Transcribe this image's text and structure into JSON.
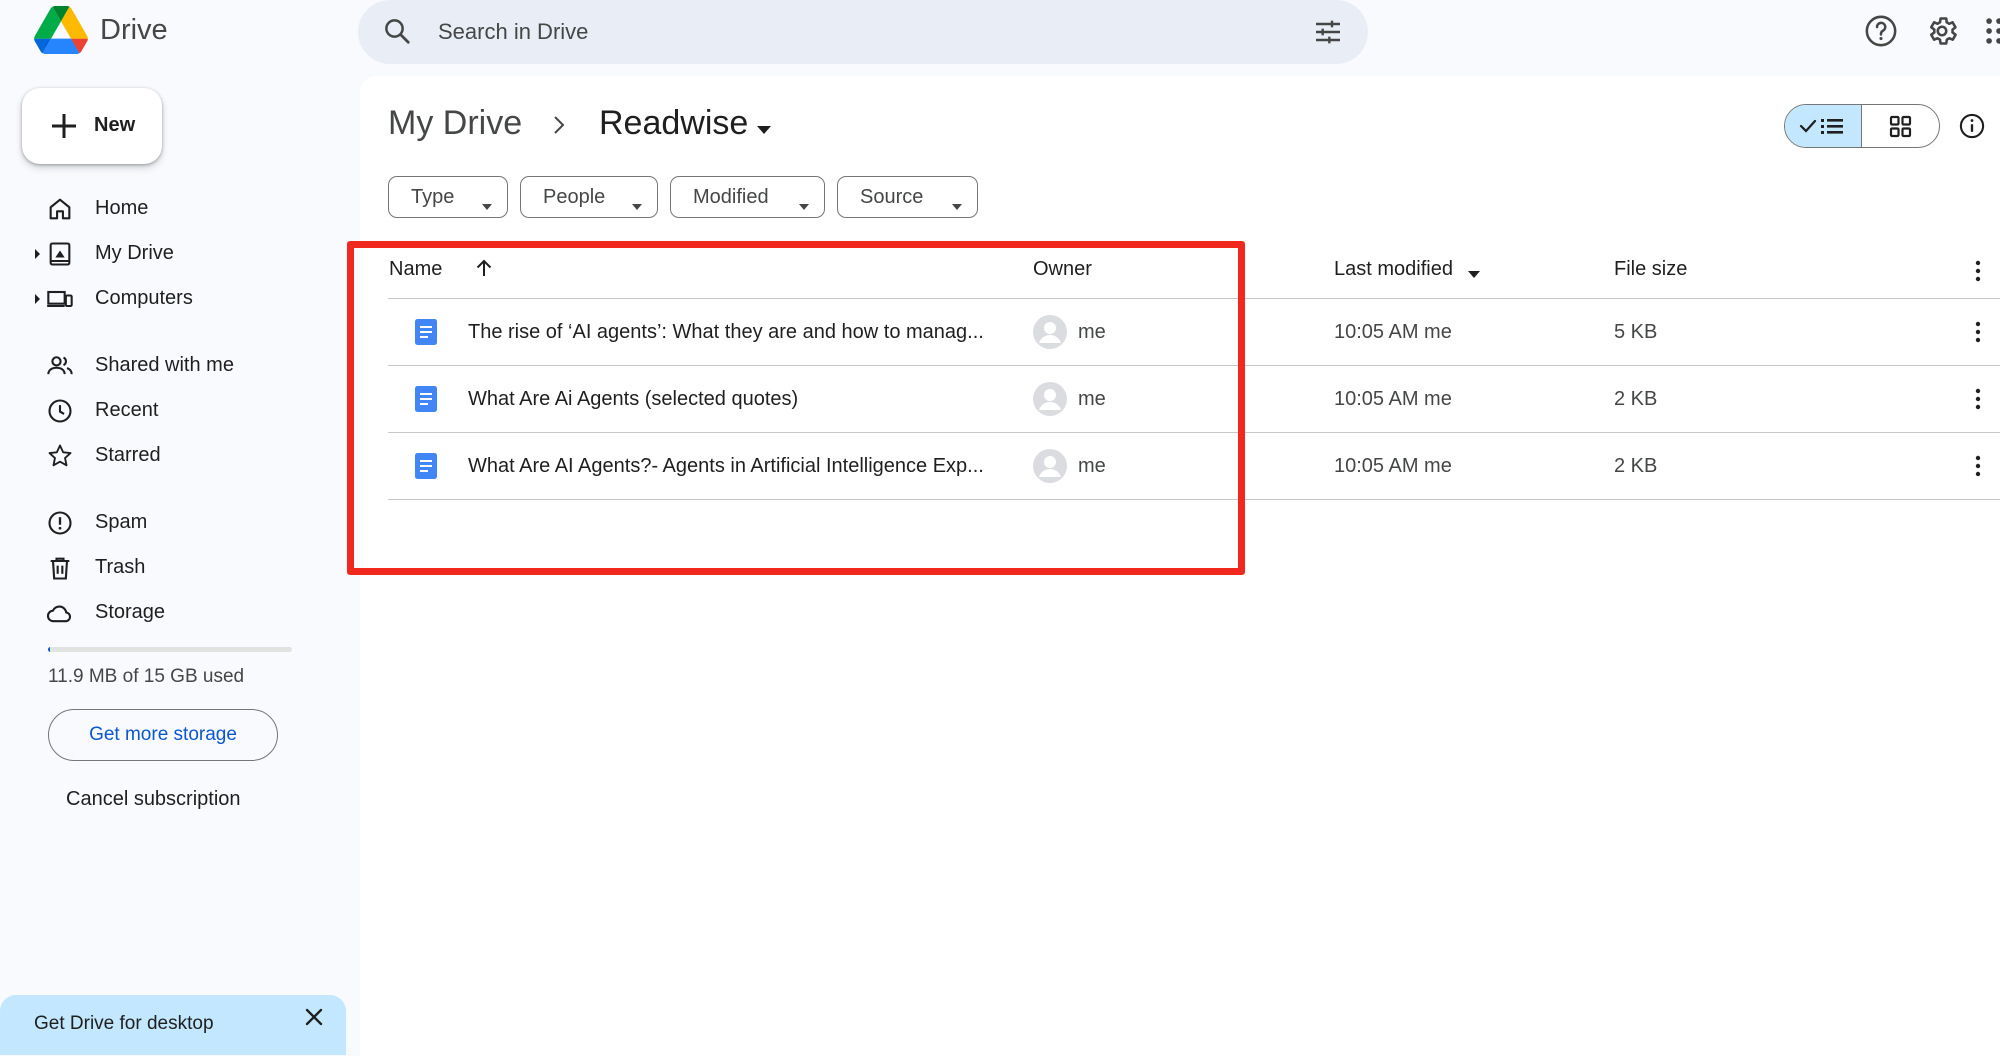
{
  "app": {
    "name": "Drive"
  },
  "search": {
    "placeholder": "Search in Drive"
  },
  "sidebar": {
    "new_label": "New",
    "items": [
      {
        "label": "Home",
        "icon": "home-icon"
      },
      {
        "label": "My Drive",
        "icon": "my-drive-icon"
      },
      {
        "label": "Computers",
        "icon": "computers-icon"
      },
      {
        "label": "Shared with me",
        "icon": "shared-icon"
      },
      {
        "label": "Recent",
        "icon": "clock-icon"
      },
      {
        "label": "Starred",
        "icon": "star-icon"
      },
      {
        "label": "Spam",
        "icon": "spam-icon"
      },
      {
        "label": "Trash",
        "icon": "trash-icon"
      },
      {
        "label": "Storage",
        "icon": "cloud-icon"
      }
    ],
    "storage_text": "11.9 MB of 15 GB used",
    "storage_fraction": 0.0008,
    "get_more_storage": "Get more storage",
    "cancel_subscription": "Cancel subscription",
    "desktop_banner": "Get Drive for desktop"
  },
  "breadcrumb": {
    "parent": "My Drive",
    "current": "Readwise"
  },
  "filters": [
    "Type",
    "People",
    "Modified",
    "Source"
  ],
  "table": {
    "headers": {
      "name": "Name",
      "owner": "Owner",
      "modified": "Last modified",
      "size": "File size"
    },
    "rows": [
      {
        "name": "The rise of ‘AI agents’: What they are and how to manag...",
        "owner": "me",
        "modified": "10:05 AM me",
        "size": "5 KB"
      },
      {
        "name": "What Are Ai Agents (selected quotes)",
        "owner": "me",
        "modified": "10:05 AM me",
        "size": "2 KB"
      },
      {
        "name": "What Are AI Agents?- Agents in Artificial Intelligence Exp...",
        "owner": "me",
        "modified": "10:05 AM me",
        "size": "2 KB"
      }
    ]
  },
  "colors": {
    "accent": "#0b57d0",
    "highlight_box": "#f0281e",
    "selected_view": "#c2e7ff",
    "doc_blue": "#4285f4"
  }
}
